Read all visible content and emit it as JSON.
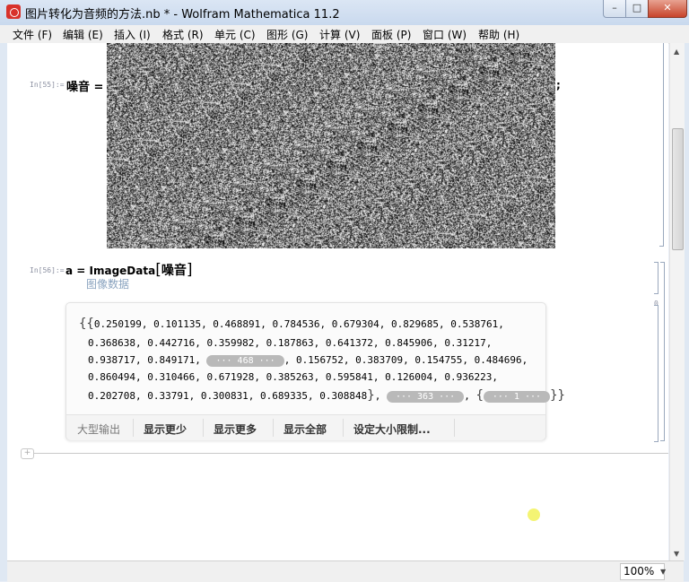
{
  "window": {
    "title": "图片转化为音频的方法.nb * - Wolfram Mathematica 11.2",
    "min_label": "–",
    "max_label": "□",
    "close_label": "✕"
  },
  "menu": [
    "文件 (F)",
    "编辑 (E)",
    "插入 (I)",
    "格式 (R)",
    "单元 (C)",
    "图形 (G)",
    "计算 (V)",
    "面板 (P)",
    "窗口 (W)",
    "帮助 (H)"
  ],
  "cells": {
    "in55": {
      "label": "In[55]:=",
      "code": "噪音 =",
      "trailing": ";"
    },
    "in56": {
      "label": "In[56]:=",
      "code_prefix": "a = ImageData",
      "bracket_open": "[",
      "code_arg": "噪音",
      "bracket_close": "]",
      "hint": "图像数据"
    },
    "out56": {
      "label": "0"
    }
  },
  "output": {
    "open_braces": "{{",
    "line1": "0.250199, 0.101135, 0.468891, 0.784536, 0.679304, 0.829685, 0.538761,",
    "line2": "0.368638, 0.442716, 0.359982, 0.187863, 0.641372, 0.845906, 0.31217,",
    "line3_pre": "0.938717, 0.849171,",
    "pill_468": "··· 468 ···",
    "line3_post": ", 0.156752, 0.383709, 0.154755, 0.484696,",
    "line4": "0.860494, 0.310466, 0.671928, 0.385263, 0.595841, 0.126004, 0.936223,",
    "line5_pre": "0.202708, 0.33791, 0.300831, 0.689335, 0.308848",
    "close1": "}",
    "sep1": ",",
    "pill_363": "··· 363 ···",
    "sep2": ",",
    "open2": "{",
    "pill_1": "··· 1 ···",
    "close2": "}}"
  },
  "footer": {
    "large_output": "大型输出",
    "show_less": "显示更少",
    "show_more": "显示更多",
    "show_all": "显示全部",
    "set_size_limit": "设定大小限制..."
  },
  "status": {
    "zoom": "100%"
  },
  "colors": {
    "titlebar": "#c9d9ee",
    "close": "#c7432a",
    "pill": "#b9b9b9",
    "hint": "#8aa3bf"
  }
}
